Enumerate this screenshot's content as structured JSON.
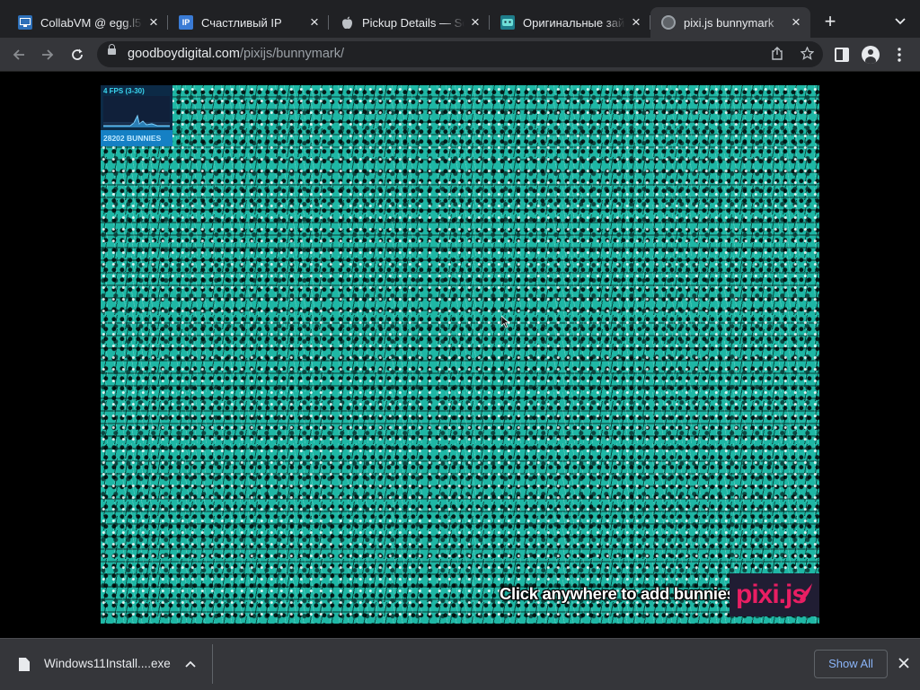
{
  "tabs": [
    {
      "title": "CollabVM @ egg.l5.c",
      "favicon": "monitor-icon"
    },
    {
      "title": "Счастливый IP",
      "favicon": "ip-icon",
      "favicon_text": "IP"
    },
    {
      "title": "Pickup Details — Se",
      "favicon": "apple-icon"
    },
    {
      "title": "Оригинальные зай",
      "favicon": "robot-icon"
    },
    {
      "title": "pixi.js bunnymark",
      "favicon": "globe-icon",
      "active": true
    }
  ],
  "toolbar": {
    "url_host": "goodboydigital.com",
    "url_path": "/pixijs/bunnymark/"
  },
  "stats": {
    "fps_text": "4 FPS (3-30)",
    "bunnies_text": "28202 BUNNIES"
  },
  "stage": {
    "cta_text": "Click anywhere to add bunnies!",
    "logo_text": "pixi.js"
  },
  "downloads": {
    "file_name": "Windows11Install....exe",
    "show_all_label": "Show All"
  },
  "colors": {
    "tabstrip_bg": "#202124",
    "toolbar_bg": "#35363a",
    "bunny_teal": "#1eb7a5",
    "pixi_pink": "#e91e63",
    "link_blue": "#8ab4f8"
  }
}
